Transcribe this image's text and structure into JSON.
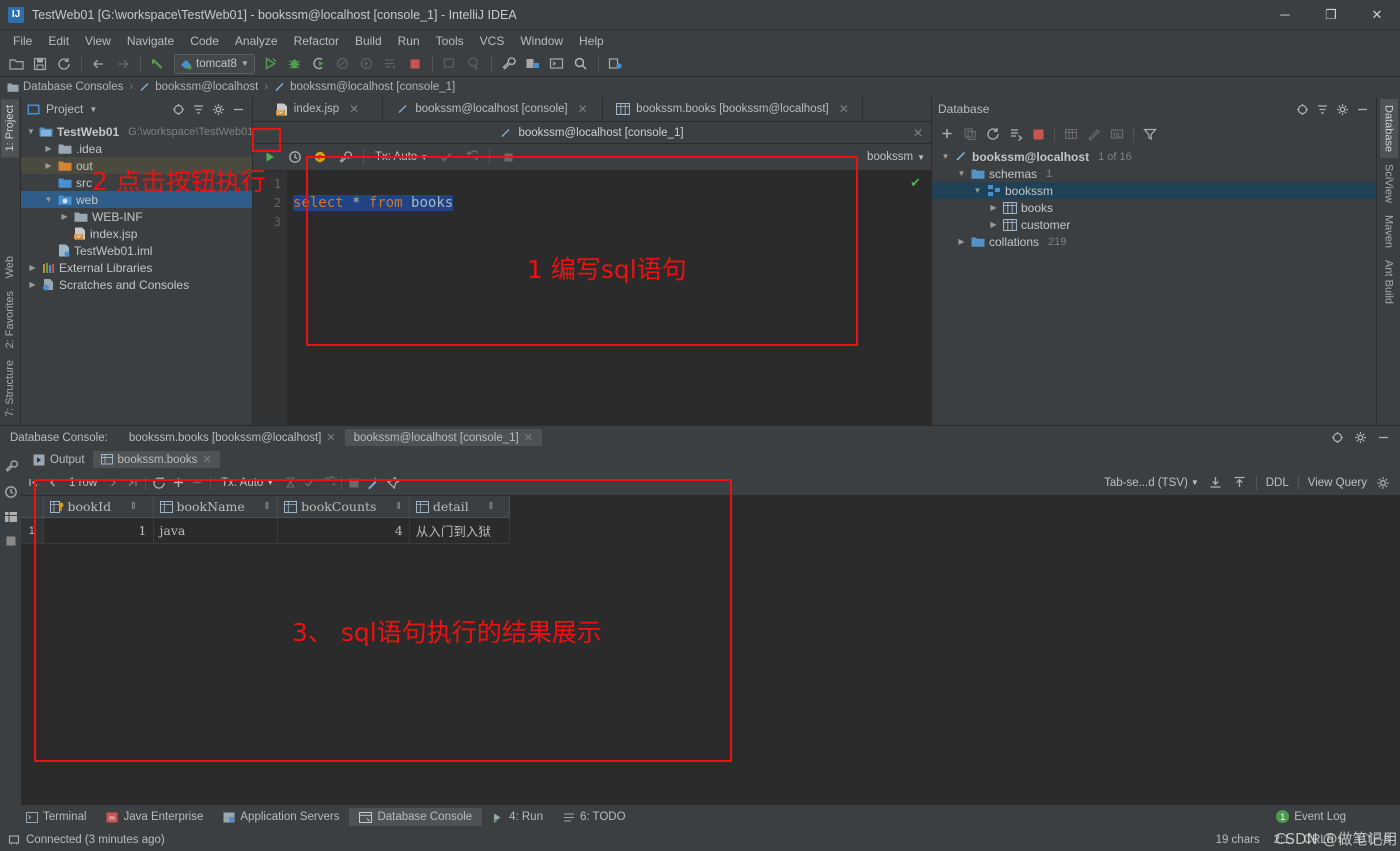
{
  "window": {
    "title": "TestWeb01 [G:\\workspace\\TestWeb01] - bookssm@localhost [console_1] - IntelliJ IDEA",
    "minimize": "─",
    "maximize": "❐",
    "close": "✕"
  },
  "menu": [
    "File",
    "Edit",
    "View",
    "Navigate",
    "Code",
    "Analyze",
    "Refactor",
    "Build",
    "Run",
    "Tools",
    "VCS",
    "Window",
    "Help"
  ],
  "toolbar": {
    "run_config": "tomcat8",
    "icons": [
      "open-folder-icon",
      "save-all-icon",
      "sync-icon",
      "back-icon",
      "forward-icon",
      "undo-icon",
      "run-icon",
      "debug-icon",
      "run-with-coverage-icon",
      "profile-icon",
      "attach-icon",
      "step-icon",
      "stop-icon",
      "build-icon",
      "update-icon",
      "settings-wrench-icon",
      "project-structure-icon",
      "console-icon",
      "search-icon",
      "sdk-icon"
    ]
  },
  "breadcrumb": [
    "Database Consoles",
    "bookssm@localhost",
    "bookssm@localhost [console_1]"
  ],
  "left_strip": {
    "top": [
      "1: Project"
    ],
    "bottom": [
      "7: Structure",
      "2: Favorites",
      "Web"
    ]
  },
  "project_panel": {
    "title": "Project",
    "actions": [
      "locate-icon",
      "collapse-all-icon",
      "gear-icon",
      "minimize-icon"
    ],
    "tree": [
      {
        "label": "TestWeb01",
        "hint": "G:\\workspace\\TestWeb01",
        "indent": 0,
        "arrow": "down",
        "icon": "module-icon",
        "state": "bold"
      },
      {
        "label": ".idea",
        "hint": "",
        "indent": 1,
        "arrow": "right",
        "icon": "folder-icon",
        "state": "normal"
      },
      {
        "label": "out",
        "hint": "",
        "indent": 1,
        "arrow": "right",
        "icon": "folder-orange-icon",
        "state": "highlight"
      },
      {
        "label": "src",
        "hint": "",
        "indent": 1,
        "arrow": "none",
        "icon": "folder-source-icon",
        "state": "normal"
      },
      {
        "label": "web",
        "hint": "",
        "indent": 1,
        "arrow": "down",
        "icon": "folder-web-icon",
        "state": "selected"
      },
      {
        "label": "WEB-INF",
        "hint": "",
        "indent": 2,
        "arrow": "right",
        "icon": "folder-icon",
        "state": "normal"
      },
      {
        "label": "index.jsp",
        "hint": "",
        "indent": 2,
        "arrow": "none",
        "icon": "jsp-file-icon",
        "state": "normal"
      },
      {
        "label": "TestWeb01.iml",
        "hint": "",
        "indent": 1,
        "arrow": "none",
        "icon": "iml-file-icon",
        "state": "normal"
      },
      {
        "label": "External Libraries",
        "hint": "",
        "indent": 0,
        "arrow": "right",
        "icon": "libraries-icon",
        "state": "normal"
      },
      {
        "label": "Scratches and Consoles",
        "hint": "",
        "indent": 0,
        "arrow": "right",
        "icon": "scratches-icon",
        "state": "normal"
      }
    ]
  },
  "editor": {
    "tabs": [
      {
        "label": "index.jsp",
        "icon": "jsp-file-icon",
        "active": false
      },
      {
        "label": "bookssm@localhost [console]",
        "icon": "console-icon",
        "active": false
      },
      {
        "label": "bookssm.books [bookssm@localhost]",
        "icon": "table-icon",
        "active": false
      }
    ],
    "subtab": {
      "label": "bookssm@localhost [console_1]",
      "icon": "console-icon"
    },
    "console_toolbar": {
      "run_button": "run-green-triangle-icon",
      "icons": [
        "history-icon",
        "params-icon",
        "wrench-icon"
      ],
      "tx_label": "Tx: Auto",
      "commit_icon": "commit-check-icon",
      "rollback_icon": "rollback-icon",
      "stop_icon": "stop-icon",
      "schema": "bookssm"
    },
    "gutter_lines": [
      "1",
      "2",
      "3"
    ],
    "code": {
      "tokens": [
        {
          "text": "select",
          "type": "keyword"
        },
        {
          "text": " ",
          "type": "plain"
        },
        {
          "text": "*",
          "type": "plain"
        },
        {
          "text": " ",
          "type": "plain"
        },
        {
          "text": "from",
          "type": "keyword"
        },
        {
          "text": " ",
          "type": "plain"
        },
        {
          "text": "books",
          "type": "table"
        }
      ],
      "full_text": "select * from books"
    },
    "inspection_ok": "✔"
  },
  "database_panel": {
    "title": "Database",
    "header_actions": [
      "locate-icon",
      "collapse-all-icon",
      "gear-icon",
      "minimize-icon"
    ],
    "toolbar_icons": [
      "add-plus-icon",
      "copy-icon",
      "refresh-icon",
      "sync-schema-icon",
      "stop-red-icon",
      "table-editor-icon",
      "modify-icon",
      "console-sql-icon",
      "filter-icon"
    ],
    "tree": [
      {
        "label": "bookssm@localhost",
        "hint": "1 of 16",
        "indent": 0,
        "arrow": "down",
        "icon": "datasource-icon",
        "state": "bold"
      },
      {
        "label": "schemas",
        "hint": "1",
        "indent": 1,
        "arrow": "down",
        "icon": "folder-blue-icon",
        "state": "normal"
      },
      {
        "label": "bookssm",
        "hint": "",
        "indent": 2,
        "arrow": "down",
        "icon": "schema-icon",
        "state": "selected"
      },
      {
        "label": "books",
        "hint": "",
        "indent": 3,
        "arrow": "right",
        "icon": "table-icon",
        "state": "normal"
      },
      {
        "label": "customer",
        "hint": "",
        "indent": 3,
        "arrow": "right",
        "icon": "table-icon",
        "state": "normal"
      },
      {
        "label": "collations",
        "hint": "219",
        "indent": 1,
        "arrow": "right",
        "icon": "folder-blue-icon",
        "state": "normal"
      }
    ]
  },
  "right_strip": [
    "Database",
    "SciView",
    "Maven",
    "Ant Build"
  ],
  "bottom_window": {
    "label": "Database Console:",
    "tabs": [
      {
        "label": "bookssm.books [bookssm@localhost]",
        "active": false
      },
      {
        "label": "bookssm@localhost [console_1]",
        "active": true
      }
    ],
    "header_actions": [
      "locate-icon",
      "gear-icon",
      "minimize-icon"
    ],
    "side_icons": [
      "wrench-icon",
      "history-icon",
      "table-icon",
      "stop-icon"
    ],
    "output_tabs": [
      {
        "label": "Output",
        "icon": "output-icon",
        "active": false
      },
      {
        "label": "bookssm.books",
        "icon": "table-icon",
        "active": true
      }
    ],
    "grid_toolbar": {
      "first_icon": "first-page-icon",
      "prev_icon": "prev-page-icon",
      "rows_label": "1 row",
      "next_icon": "next-page-icon",
      "last_icon": "last-page-icon",
      "reload_icon": "reload-icon",
      "add_row_icon": "add-row-icon",
      "delete_row_icon": "delete-row-icon",
      "tx_label": "Tx: Auto",
      "pending_icon": "pending-icon",
      "commit_icon": "commit-check-icon",
      "rollback_icon": "rollback-icon",
      "stop_icon": "stop-icon",
      "magic_icon": "magic-wand-icon",
      "pin_icon": "pin-icon",
      "format_label": "Tab-se...d (TSV)",
      "export_icon": "export-icon",
      "import_icon": "import-icon",
      "ddl_label": "DDL",
      "view_query_label": "View Query",
      "settings_icon": "gear-icon"
    },
    "result_grid": {
      "columns": [
        {
          "name": "bookId",
          "icon": "primary-key-icon",
          "align": "right"
        },
        {
          "name": "bookName",
          "icon": "column-icon",
          "align": "left"
        },
        {
          "name": "bookCounts",
          "icon": "column-icon",
          "align": "right"
        },
        {
          "name": "detail",
          "icon": "column-icon",
          "align": "left"
        }
      ],
      "rows": [
        {
          "num": "1",
          "cells": [
            "1",
            "java",
            "4",
            "从入门到入狱"
          ]
        }
      ]
    }
  },
  "status": {
    "tabs": [
      {
        "label": "Terminal",
        "icon": "terminal-icon",
        "active": false
      },
      {
        "label": "Java Enterprise",
        "icon": "java-ee-icon",
        "active": false
      },
      {
        "label": "Application Servers",
        "icon": "app-server-icon",
        "active": false
      },
      {
        "label": "Database Console",
        "icon": "db-console-icon",
        "active": true
      },
      {
        "label": "4: Run",
        "icon": "run-icon",
        "active": false
      },
      {
        "label": "6: TODO",
        "icon": "todo-icon",
        "active": false
      }
    ],
    "event_log": {
      "count": "1",
      "label": "Event Log"
    },
    "connection": "Connected (3 minutes ago)",
    "chars": "19 chars",
    "caret": "2:1",
    "line_sep": "CRLF",
    "encoding": "UTF-8",
    "lock_icon": "lock-icon"
  },
  "annotations": [
    {
      "id": "anno-1",
      "text": "1  编写sql语句"
    },
    {
      "id": "anno-2",
      "text": "2  点击按钮执行"
    },
    {
      "id": "anno-3",
      "text": "3、 sql语句执行的结果展示"
    }
  ],
  "watermark": "CSDN @做笔记用",
  "colors": {
    "accent_red": "#ee1111",
    "selection_blue": "#2f5d8a",
    "run_green": "#4fb14f",
    "bg_panel": "#3c3f41",
    "bg_editor": "#2b2b2b"
  }
}
